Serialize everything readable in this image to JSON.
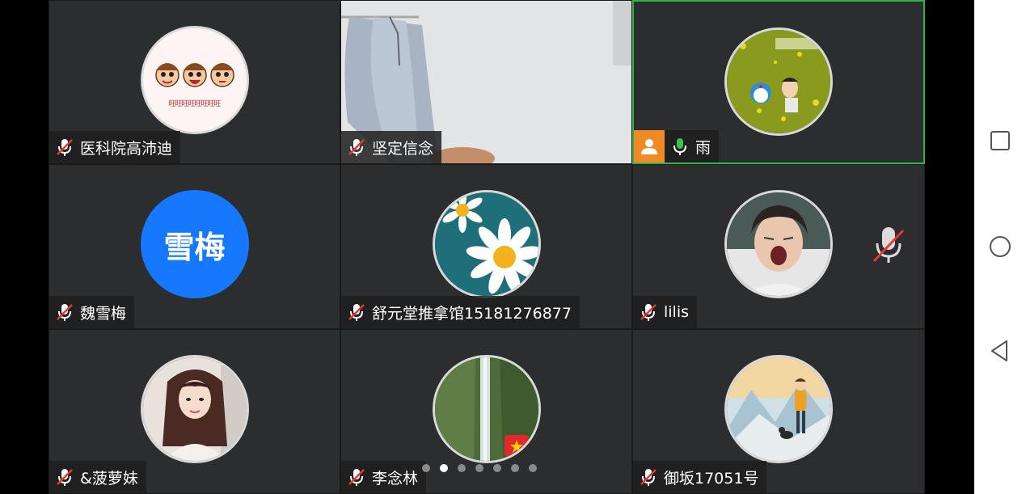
{
  "participants": [
    {
      "name": "医科院高沛迪",
      "avatar": "cartoon-faces",
      "muted": true
    },
    {
      "name": "坚定信念",
      "avatar": "video",
      "muted": true
    },
    {
      "name": "雨",
      "avatar": "doraemon-grass",
      "muted": false,
      "host": true,
      "speaking": true
    },
    {
      "name": "魏雪梅",
      "avatar_text": "雪梅",
      "muted": true
    },
    {
      "name": "舒元堂推拿馆15181276877",
      "avatar": "daisy",
      "muted": true
    },
    {
      "name": "lilis",
      "avatar": "yawning-man",
      "muted": true
    },
    {
      "name": "&菠萝妹",
      "avatar": "girl-photo",
      "muted": true
    },
    {
      "name": "李念林",
      "avatar": "waterfall",
      "muted": true
    },
    {
      "name": "御坂17051号",
      "avatar": "mountain-illustration",
      "muted": true
    }
  ],
  "cartoon_avatar_text": "旺旺旺旺旺旺旺旺",
  "pagination": {
    "total": 7,
    "current": 2
  },
  "colors": {
    "tile_bg": "#2c2d2f",
    "active_border": "#2fb34a",
    "host_badge": "#f08a24",
    "text_avatar": "#1677ff",
    "muted_red": "#e03a3a"
  },
  "navbar": [
    "recents-square-icon",
    "home-circle-icon",
    "back-triangle-icon"
  ]
}
